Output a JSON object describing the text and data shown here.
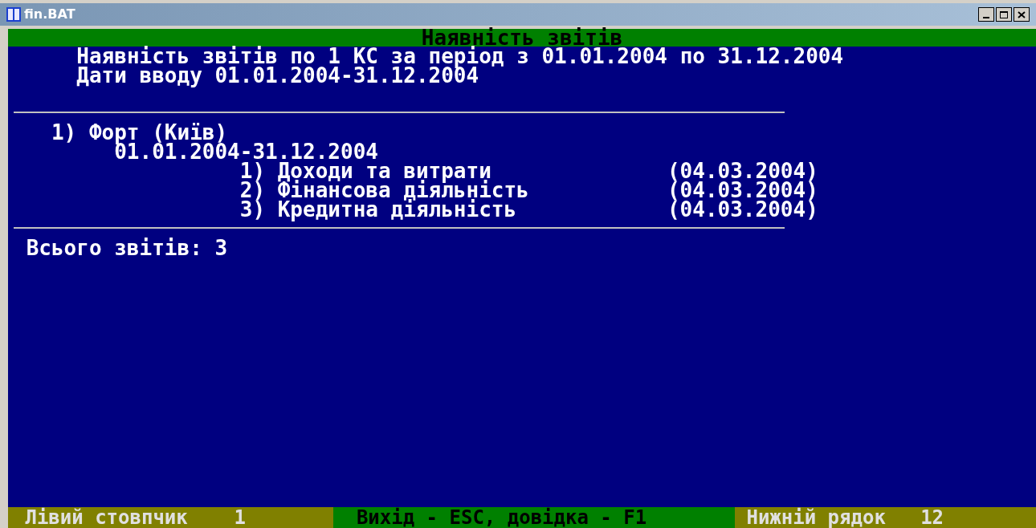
{
  "window": {
    "title": "fin.BAT"
  },
  "header": "Наявність звітів",
  "intro": [
    "Наявність звітів по 1 КС за період з 01.01.2004 по 31.12.2004",
    "Дати вводу 01.01.2004-31.12.2004"
  ],
  "organization": {
    "name": "1) Форт (Київ)",
    "period": "01.01.2004-31.12.2004",
    "reports": [
      {
        "name": "1) Доходи та витрати",
        "date": "(04.03.2004)"
      },
      {
        "name": "2) Фінансова діяльність",
        "date": "(04.03.2004)"
      },
      {
        "name": "3) Кредитна діяльність",
        "date": "(04.03.2004)"
      }
    ]
  },
  "total": "Всього звітів: 3",
  "status_bar": {
    "left_label": "Лівий стовпчик",
    "left_value": "1",
    "help": "Вихід - ESC, довідка - F1",
    "bottom_label": "Нижній рядок",
    "bottom_value": "12"
  }
}
